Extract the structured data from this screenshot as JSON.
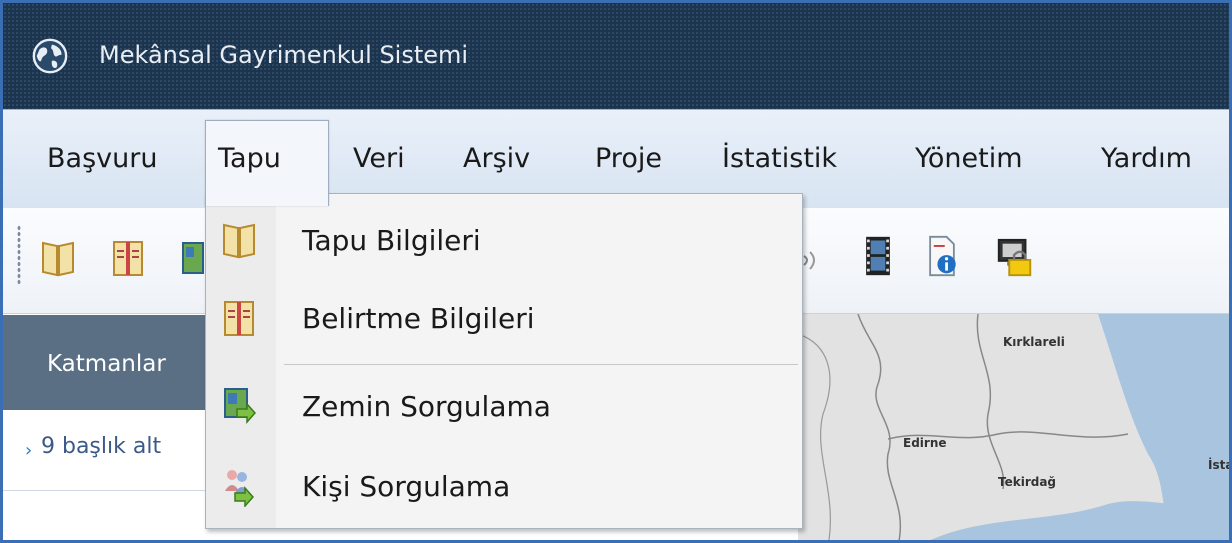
{
  "window": {
    "title": "Mekânsal Gayrimenkul Sistemi",
    "icon": "globe-icon"
  },
  "menubar": {
    "items": [
      "Başvuru",
      "Tapu",
      "Veri",
      "Arşiv",
      "Proje",
      "İstatistik",
      "Yönetim",
      "Yardım"
    ],
    "active": "Tapu"
  },
  "toolbar": {
    "icons": [
      "book-icon",
      "notebook-icon",
      "map-search-icon",
      "speaker-icon",
      "film-icon",
      "document-info-icon",
      "monitor-lock-icon"
    ]
  },
  "left_panel": {
    "header": "Katmanlar",
    "subheader": "9 başlık alt"
  },
  "dropdown": {
    "items": [
      {
        "label": "Tapu Bilgileri",
        "icon": "book-icon"
      },
      {
        "label": "Belirtme Bilgileri",
        "icon": "notebook-icon"
      },
      {
        "label": "Zemin Sorgulama",
        "icon": "map-search-icon"
      },
      {
        "label": "Kişi Sorgulama",
        "icon": "person-search-icon"
      }
    ]
  },
  "map": {
    "labels": [
      "Kırklareli",
      "Edirne",
      "Tekirdağ",
      "İsta"
    ]
  },
  "colors": {
    "titlebar_bg": "#1b3550",
    "menubar_bg": "#dce7f4",
    "layers_header_bg": "#5a6f84",
    "frame_border": "#3a6fb5",
    "map_sea": "#a8c4de",
    "map_land": "#e2e2e2"
  }
}
